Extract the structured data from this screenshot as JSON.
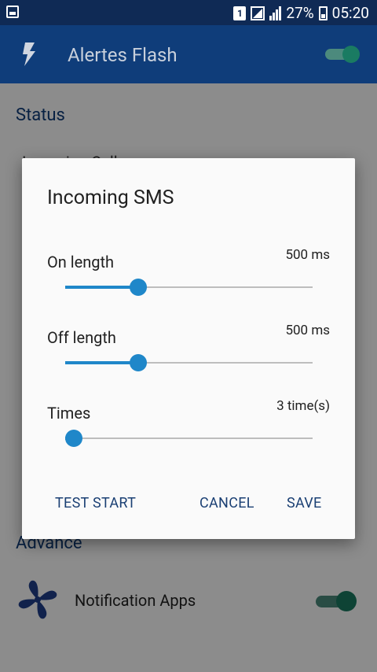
{
  "status_bar": {
    "sim_label": "1",
    "battery": "27%",
    "time": "05:20"
  },
  "app_bar": {
    "title": "Alertes Flash",
    "switch_on": true,
    "flash_icon": "flash-icon"
  },
  "background": {
    "status_section": "Status",
    "status_row_partial": "Incoming Call",
    "advance_section": "Advance",
    "notification_apps_label": "Notification Apps",
    "notification_apps_enabled": true,
    "notification_icon": "fan-icon"
  },
  "dialog": {
    "title": "Incoming SMS",
    "sliders": [
      {
        "label": "On length",
        "value_text": "500 ms",
        "fraction": 0.295
      },
      {
        "label": "Off length",
        "value_text": "500 ms",
        "fraction": 0.295
      },
      {
        "label": "Times",
        "value_text": "3 time(s)",
        "fraction": 0.035
      }
    ],
    "buttons": {
      "test_start": "TEST START",
      "cancel": "CANCEL",
      "save": "SAVE"
    }
  },
  "colors": {
    "primary": "#0f3d7a",
    "accent": "#1f87c9",
    "switch_on": "#1a7b62"
  }
}
